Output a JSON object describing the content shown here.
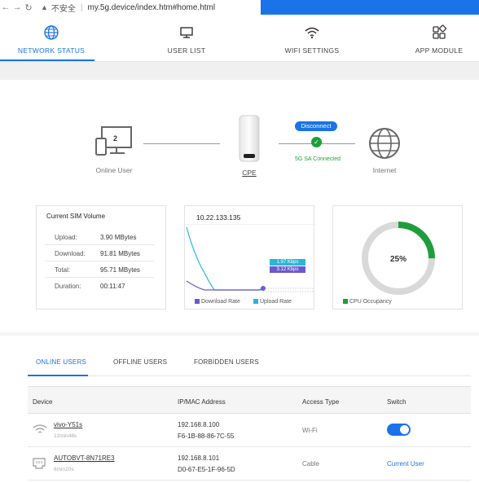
{
  "browser": {
    "security_text": "不安全",
    "url": "my.5g.device/index.htm#home.html"
  },
  "nav": {
    "tabs": [
      {
        "label": "NETWORK STATUS",
        "icon": "globe-icon",
        "active": true
      },
      {
        "label": "USER LIST",
        "icon": "monitor-icon",
        "active": false
      },
      {
        "label": "WIFI SETTINGS",
        "icon": "wifi-icon",
        "active": false
      },
      {
        "label": "APP MODULE",
        "icon": "app-grid-icon",
        "active": false
      }
    ]
  },
  "topology": {
    "online_user_count": "2",
    "online_user_label": "Online User",
    "cpe_label": "CPE",
    "disconnect_label": "Disconnect",
    "connection_status": "5G SA Connected",
    "internet_label": "Internet"
  },
  "sim": {
    "title": "Current SIM Volume",
    "rows": [
      {
        "label": "Upload:",
        "value": "3.90 MBytes"
      },
      {
        "label": "Download:",
        "value": "91.81 MBytes"
      },
      {
        "label": "Total:",
        "value": "95.71 MBytes"
      },
      {
        "label": "Duration:",
        "value": "00:11:47"
      }
    ]
  },
  "rate": {
    "ip": "10.22.133.135",
    "upload_badge": "1.97 Kbps",
    "download_badge": "3.12 Kbps",
    "download_legend": "Download Rate",
    "upload_legend": "Upload Rate"
  },
  "cpu": {
    "percent_text": "25%",
    "percent": 25,
    "legend": "CPU Occupancy"
  },
  "users": {
    "tabs": [
      {
        "label": "ONLINE USERS",
        "active": true
      },
      {
        "label": "OFFLINE USERS",
        "active": false
      },
      {
        "label": "FORBIDDEN USERS",
        "active": false
      }
    ],
    "columns": [
      "Device",
      "IP/MAC Address",
      "Access Type",
      "Switch"
    ],
    "rows": [
      {
        "name": "vivo-Y51s",
        "duration": "12min48s",
        "ip": "192.168.8.100",
        "mac": "F6-1B-88-86-7C-55",
        "access": "Wi-Fi",
        "switch_on": true
      },
      {
        "name": "AUTOBVT-8N71RE3",
        "duration": "6min20s",
        "ip": "192.168.8.101",
        "mac": "D0-67-E5-1F-96-5D",
        "access": "Cable",
        "switch_text": "Current User"
      }
    ]
  },
  "colors": {
    "accent": "#1a73e8",
    "success": "#1e9e3a",
    "download": "#6a5acd",
    "upload": "#29b6d8"
  }
}
